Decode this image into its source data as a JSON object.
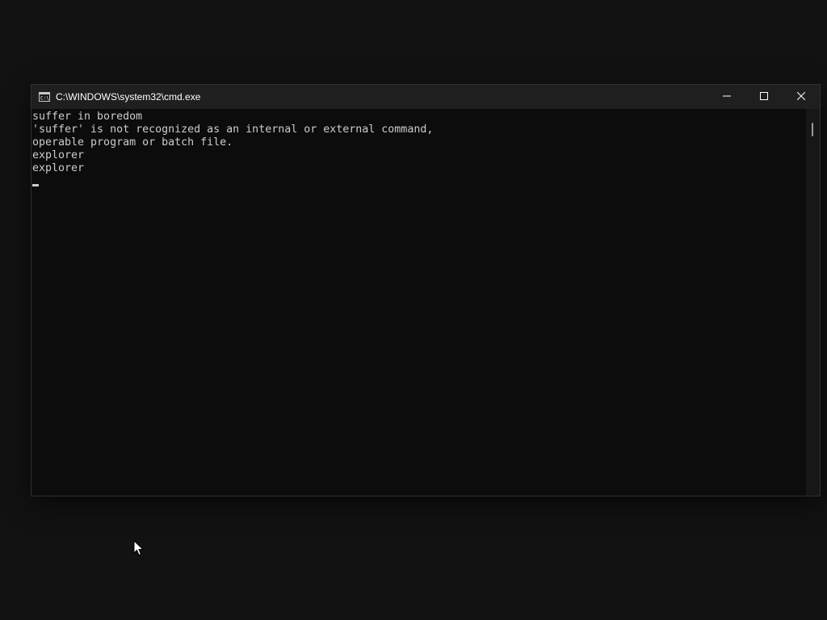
{
  "window": {
    "title": "C:\\WINDOWS\\system32\\cmd.exe",
    "icon": "cmd-icon"
  },
  "caption_buttons": {
    "minimize_icon": "minimize-icon",
    "maximize_icon": "maximize-icon",
    "close_icon": "close-icon"
  },
  "console": {
    "lines": [
      "suffer in boredom",
      "'suffer' is not recognized as an internal or external command,",
      "operable program or batch file.",
      "explorer",
      "explorer"
    ],
    "text_color": "#cccccc",
    "background": "#0c0c0c"
  },
  "colors": {
    "desktop": "#121212",
    "titlebar": "#1f1f1f",
    "title_text": "#ffffff"
  }
}
